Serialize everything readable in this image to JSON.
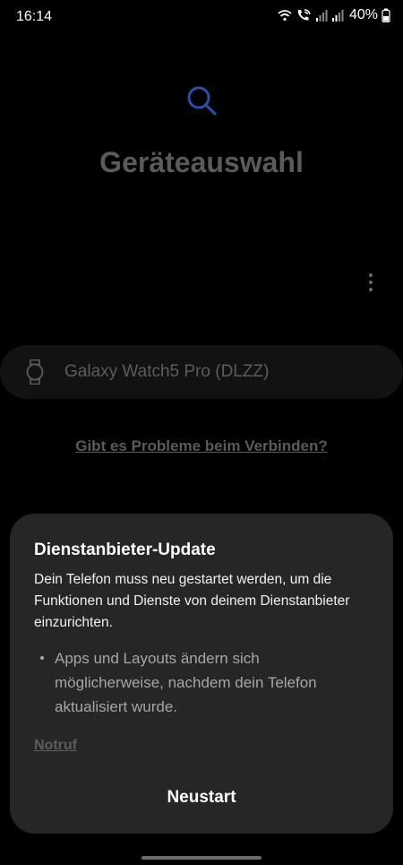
{
  "status_bar": {
    "time": "16:14",
    "battery_text": "40%",
    "icons": [
      "wifi-icon",
      "wifi-calling-icon",
      "signal-icon",
      "signal-icon",
      "battery-icon"
    ]
  },
  "main": {
    "title": "Geräteauswahl",
    "icon": "search-icon",
    "menu_icon": "more-vert-icon",
    "device": {
      "icon": "watch-icon",
      "name": "Galaxy Watch5 Pro (DLZZ)"
    },
    "help_link": "Gibt es Probleme beim Verbinden?"
  },
  "dialog": {
    "title": "Dienstanbieter-Update",
    "body": "Dein Telefon muss neu gestartet werden, um die Funktionen und Dienste von deinem Dienstanbieter einzurichten.",
    "bullet": "Apps und Layouts ändern sich möglicherweise, nachdem dein Telefon aktualisiert wurde.",
    "emergency_link": "Notruf",
    "restart_button": "Neustart"
  },
  "colors": {
    "background": "#000000",
    "dialog": "#262626",
    "search_icon": "#2a4fa8",
    "dim_text": "#5a5a5a"
  }
}
